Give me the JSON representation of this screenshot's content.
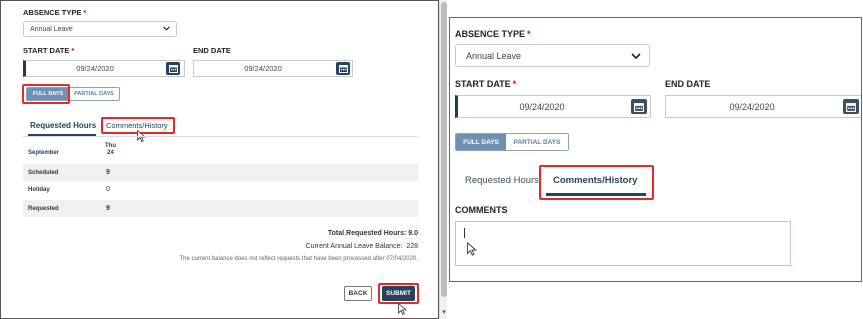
{
  "left": {
    "absence_type_label": "ABSENCE TYPE",
    "absence_type_value": "Annual Leave",
    "start_date_label": "START DATE",
    "start_date_value": "09/24/2020",
    "end_date_label": "END DATE",
    "end_date_value": "09/24/2020",
    "full_days_label": "FULL DAYS",
    "partial_days_label": "PARTIAL DAYS",
    "tabs": [
      {
        "label": "Requested Hours",
        "active": true
      },
      {
        "label": "Comments/History",
        "active": false
      }
    ],
    "table": {
      "month": "September",
      "day_name": "Thu",
      "day_number": "24",
      "rows": [
        {
          "label": "Scheduled",
          "value": "9",
          "shaded": true,
          "bold": true
        },
        {
          "label": "Holiday",
          "value": "0",
          "shaded": false,
          "bold": false
        },
        {
          "label": "Requested",
          "value": "9",
          "shaded": true,
          "bold": true
        }
      ]
    },
    "total_requested_label": "Total Requested Hours:",
    "total_requested_value": "9.0",
    "balance_label": "Current Annual Leave Balance:",
    "balance_value": "228",
    "balance_note": "The current balance does not reflect requests that have been processed after 07/04/2020.",
    "back_label": "BACK",
    "submit_label": "SUBMIT"
  },
  "right": {
    "absence_type_label": "ABSENCE TYPE",
    "absence_type_value": "Annual Leave",
    "start_date_label": "START DATE",
    "start_date_value": "09/24/2020",
    "end_date_label": "END DATE",
    "end_date_value": "09/24/2020",
    "full_days_label": "FULL DAYS",
    "partial_days_label": "PARTIAL DAYS",
    "tabs": [
      {
        "label": "Requested Hours",
        "active": false
      },
      {
        "label": "Comments/History",
        "active": true
      }
    ],
    "comments_label": "COMMENTS",
    "comments_value": ""
  },
  "colors": {
    "highlight_box": "#e12b2b",
    "primary": "#26425f",
    "required_asterisk": "#d0021b",
    "toggle_active": "#6f8fb3"
  },
  "icons": [
    "calendar-icon",
    "chevron-down-icon",
    "mouse-cursor-icon",
    "text-cursor-icon"
  ]
}
